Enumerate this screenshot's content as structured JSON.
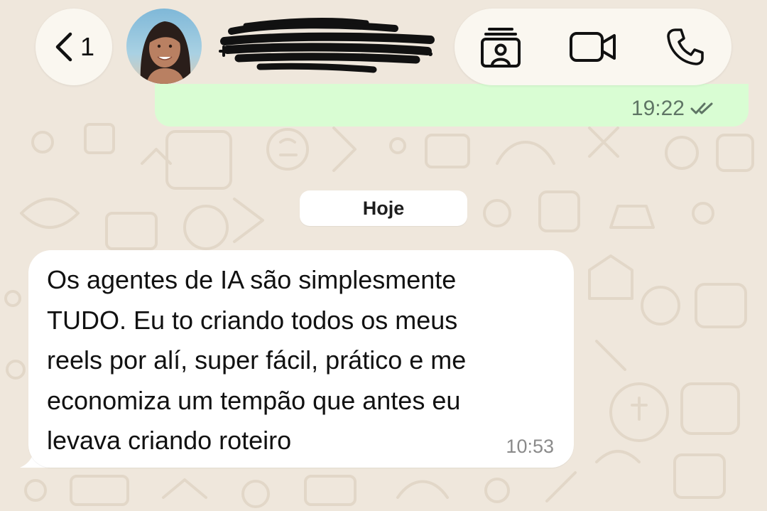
{
  "header": {
    "back_count": "1",
    "back_icon": "chevron-left-icon",
    "actions": [
      {
        "icon": "contact-card-icon"
      },
      {
        "icon": "video-camera-icon"
      },
      {
        "icon": "phone-icon"
      }
    ]
  },
  "previous_message": {
    "time": "19:22",
    "status_icon": "double-check-icon"
  },
  "date_separator": {
    "label": "Hoje"
  },
  "message": {
    "text": "Os agentes de IA são simplesmente\nTUDO. Eu to criando todos os meus\nreels por alí, super fácil, prático e me\neconomiza um tempão que antes eu\nlevava criando roteiro",
    "time": "10:53"
  },
  "colors": {
    "wallpaper": "#efe7dc",
    "outgoing_bubble": "#d9fdd3",
    "incoming_bubble": "#ffffff",
    "pill_background": "#faf8f0"
  }
}
